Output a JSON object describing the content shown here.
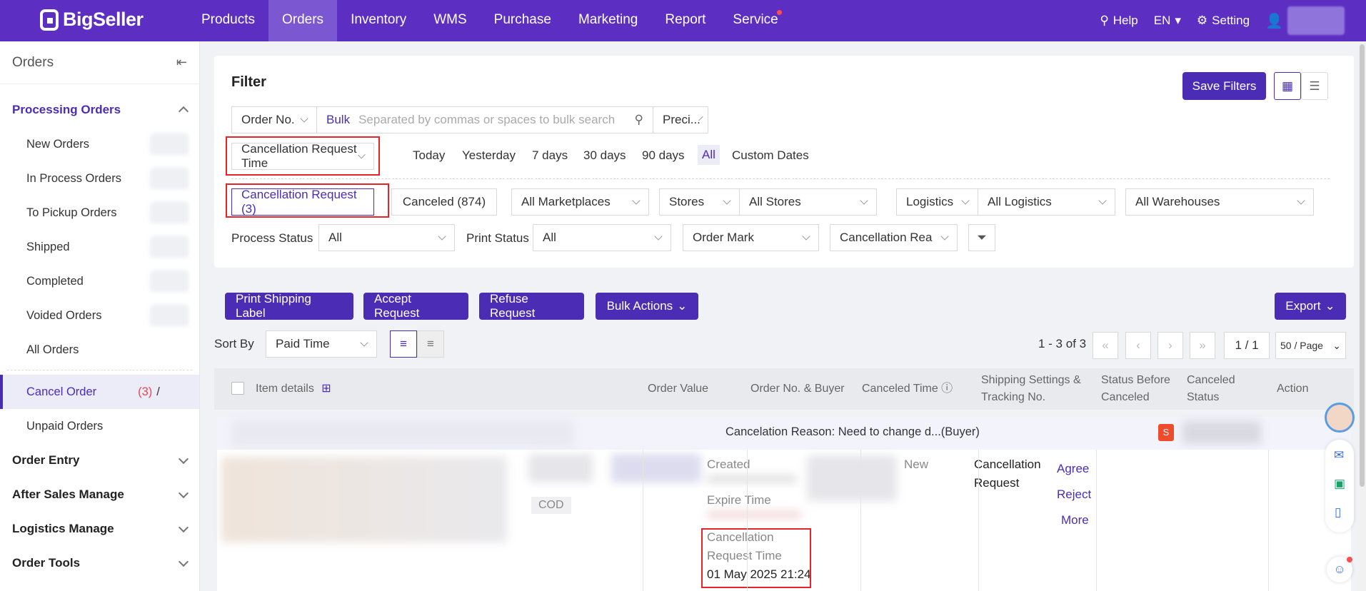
{
  "brand": "BigSeller",
  "nav": [
    "Products",
    "Orders",
    "Inventory",
    "WMS",
    "Purchase",
    "Marketing",
    "Report",
    "Service"
  ],
  "top_right": {
    "help": "Help",
    "lang": "EN",
    "setting": "Setting"
  },
  "sidebar": {
    "title": "Orders",
    "group_processing": "Processing Orders",
    "items": [
      "New Orders",
      "In Process Orders",
      "To Pickup Orders",
      "Shipped",
      "Completed",
      "Voided Orders",
      "All Orders"
    ],
    "cancel_order": "Cancel Order",
    "cancel_count": "(3)",
    "cancel_slash": "/",
    "unpaid": "Unpaid Orders",
    "groups": [
      "Order Entry",
      "After Sales Manage",
      "Logistics Manage",
      "Order Tools"
    ]
  },
  "filter": {
    "title": "Filter",
    "save_filters": "Save Filters",
    "order_no": "Order No.",
    "bulk": "Bulk",
    "search_placeholder": "Separated by commas or spaces to bulk search",
    "precise": "Preci...",
    "time_type": "Cancellation Request Time",
    "dates": [
      "Today",
      "Yesterday",
      "7 days",
      "30 days",
      "90 days",
      "All",
      "Custom Dates"
    ],
    "tab_cancel_request": "Cancellation Request (3)",
    "tab_canceled": "Canceled (874)",
    "all_marketplaces": "All Marketplaces",
    "stores": "Stores",
    "all_stores": "All Stores",
    "logistics": "Logistics",
    "all_logistics": "All Logistics",
    "all_warehouses": "All Warehouses",
    "process_status_label": "Process Status",
    "process_status": "All",
    "print_status_label": "Print Status",
    "print_status": "All",
    "order_mark": "Order Mark",
    "cancellation_reason": "Cancellation Rea"
  },
  "toolbar": {
    "print": "Print Shipping Label",
    "accept": "Accept Request",
    "refuse": "Refuse Request",
    "bulk": "Bulk Actions",
    "export": "Export",
    "sort_by": "Sort By",
    "sort_field": "Paid Time",
    "range": "1 - 3 of 3",
    "page": "1 / 1",
    "per_page": "50 / Page"
  },
  "table": {
    "headers": {
      "item": "Item details",
      "value": "Order Value",
      "orderno": "Order No. & Buyer",
      "canceled_time": "Canceled Time",
      "shipping": "Shipping Settings & Tracking No.",
      "status_before": "Status Before Canceled",
      "canceled_status": "Canceled Status",
      "action": "Action"
    },
    "reason": "Cancelation Reason: Need to change d...(Buyer)",
    "cod": "COD",
    "created": "Created",
    "expire": "Expire Time",
    "request_time_label": "Cancellation Request Time",
    "request_time": "01 May 2025 21:24",
    "status_before": "New",
    "canceled_status": "Cancellation Request",
    "actions": [
      "Agree",
      "Reject",
      "More"
    ]
  }
}
